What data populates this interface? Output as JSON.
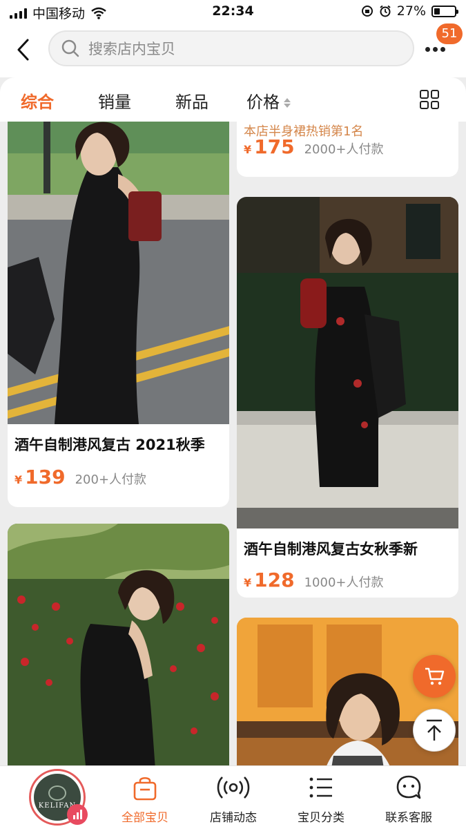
{
  "status_bar": {
    "carrier": "中国移动",
    "time": "22:34",
    "battery_percent": "27%",
    "battery_level": 0.27,
    "icons": [
      "signal-icon",
      "wifi-icon",
      "orientation-lock-icon",
      "alarm-icon",
      "battery-icon"
    ]
  },
  "header": {
    "search_placeholder": "搜索店内宝贝",
    "message_count": "51"
  },
  "sort_tabs": [
    {
      "label": "综合",
      "active": true
    },
    {
      "label": "销量",
      "active": false
    },
    {
      "label": "新品",
      "active": false
    },
    {
      "label": "价格",
      "active": false
    }
  ],
  "products": {
    "left": [
      {
        "title": "酒午自制港风复古 2021秋季",
        "currency": "¥",
        "price": "139",
        "sold": "200+人付款"
      },
      {
        "title": "",
        "currency": "¥",
        "price": "",
        "sold": ""
      }
    ],
    "right": [
      {
        "hot_label": "本店半身裙热销第1名",
        "currency": "¥",
        "price": "175",
        "sold": "2000+人付款"
      },
      {
        "title": "酒午自制港风复古女秋季新",
        "currency": "¥",
        "price": "128",
        "sold": "1000+人付款"
      }
    ]
  },
  "bottom_nav": {
    "logo_text": "KELIFAN",
    "items": [
      {
        "label": "全部宝贝",
        "icon": "shopping-bag-icon",
        "active": true
      },
      {
        "label": "店铺动态",
        "icon": "broadcast-icon",
        "active": false
      },
      {
        "label": "宝贝分类",
        "icon": "category-list-icon",
        "active": false
      },
      {
        "label": "联系客服",
        "icon": "customer-service-icon",
        "active": false
      }
    ]
  },
  "colors": {
    "accent": "#f06a2b",
    "hot_label": "#d4864a",
    "muted_text": "#888888"
  }
}
